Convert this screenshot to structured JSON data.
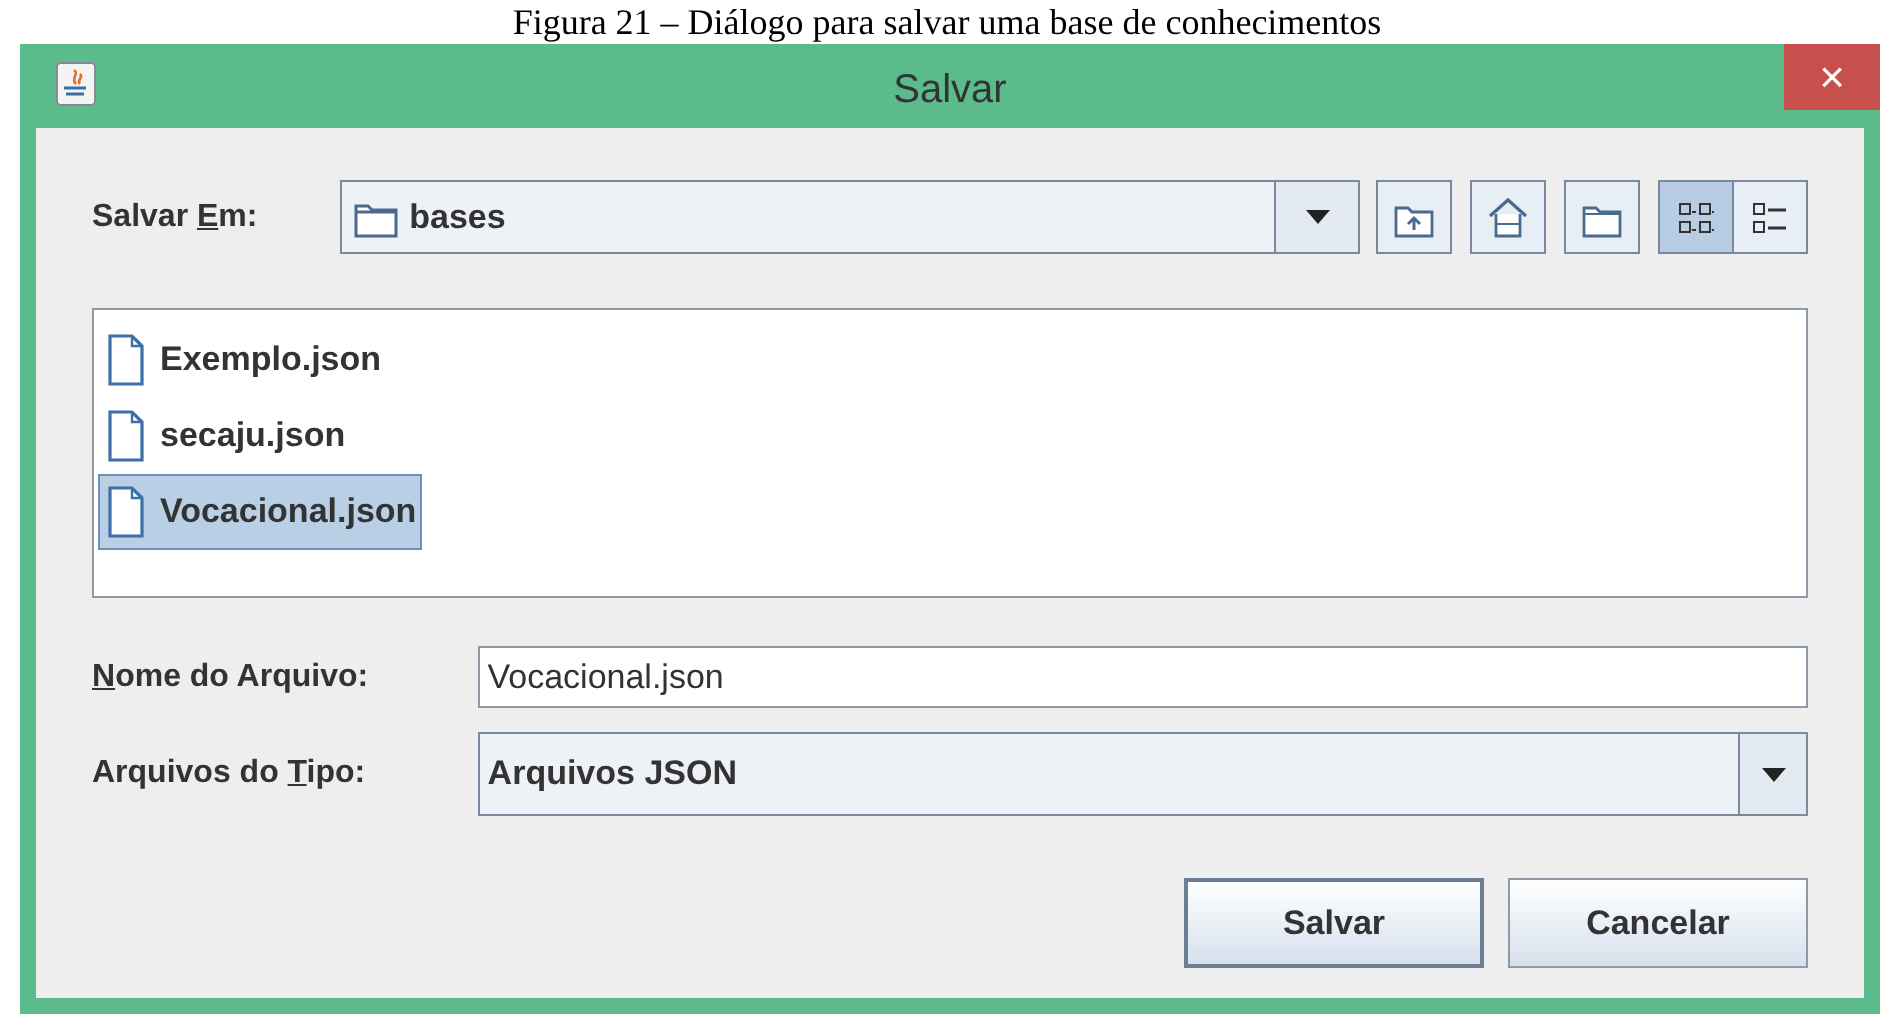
{
  "caption": "Figura 21 – Diálogo para salvar uma base de conhecimentos",
  "window": {
    "title": "Salvar",
    "close": "×"
  },
  "look_in": {
    "label": {
      "before": "Salvar ",
      "mnemonic": "E",
      "after": "m:"
    },
    "value": "bases"
  },
  "toolbar": [
    {
      "kind": "up",
      "selected": false
    },
    {
      "kind": "home",
      "selected": false
    },
    {
      "kind": "new-folder",
      "selected": false
    },
    {
      "kind": "list",
      "selected": true
    },
    {
      "kind": "details",
      "selected": false
    }
  ],
  "files": [
    {
      "name": "Exemplo.json",
      "selected": false
    },
    {
      "name": "secaju.json",
      "selected": false
    },
    {
      "name": "Vocacional.json",
      "selected": true
    }
  ],
  "file_name": {
    "label": {
      "mnemonic": "N",
      "after": "ome do Arquivo:"
    },
    "value": "Vocacional.json"
  },
  "file_type": {
    "label": {
      "before": "Arquivos do ",
      "mnemonic": "T",
      "after": "ipo:"
    },
    "value": "Arquivos JSON"
  },
  "buttons": [
    {
      "label": "Salvar",
      "selected": true
    },
    {
      "label": "Cancelar",
      "selected": false
    }
  ]
}
